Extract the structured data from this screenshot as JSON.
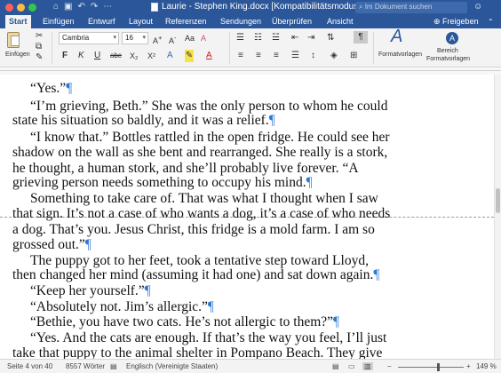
{
  "title_bar": {
    "title": "Laurie - Stephen King.docx [Kompatibilitätsmodus]",
    "search_placeholder": "Im Dokument suchen"
  },
  "tabs": [
    "Start",
    "Einfügen",
    "Entwurf",
    "Layout",
    "Referenzen",
    "Sendungen",
    "Überprüfen",
    "Ansicht"
  ],
  "share_label": "Freigeben",
  "ribbon": {
    "paste_label": "Einfügen",
    "font_name": "Cambria",
    "font_size": "16",
    "bold": "F",
    "italic": "K",
    "underline": "U",
    "strike": "abc",
    "subscript": "X₂",
    "superscript": "X²",
    "styles_label": "Formatvorlagen",
    "pane_label_line1": "Bereich",
    "pane_label_line2": "Formatvorlagen"
  },
  "document": {
    "lines": [
      "“Yes.”",
      "“I’m grieving, Beth.” She was the only person to whom he could",
      "state his situation so baldly, and it was a relief.",
      "“I know that.” Bottles rattled in the open fridge. He could see her",
      "shadow on the wall as she bent and rearranged. She really is a stork,",
      "he thought, a human stork, and she’ll probably live forever. “A",
      "grieving person needs something to occupy his mind.",
      "Something to take care of. That was what I thought when I saw",
      "that sign. It’s not a case of who wants a dog, it’s a case of who needs",
      "a dog. That’s you. Jesus Christ, this fridge is a mold farm. I am so",
      "grossed out.”",
      "The puppy got to her feet, took a tentative step toward Lloyd,",
      "then changed her mind (assuming it had one) and sat down again.",
      "“Keep her yourself.”",
      "“Absolutely not. Jim’s allergic.”",
      "“Bethie, you have two cats. He’s not allergic to them?”",
      "“Yes. And the cats are enough. If that’s the way you feel, I’ll just",
      "take that puppy to the animal shelter in Pompano Beach. They give"
    ],
    "pilcrow": "¶"
  },
  "status_bar": {
    "page_info": "Seite 4 von 40",
    "word_count": "8557 Wörter",
    "language": "Englisch (Vereinigte Staaten)",
    "zoom": "149 %"
  }
}
